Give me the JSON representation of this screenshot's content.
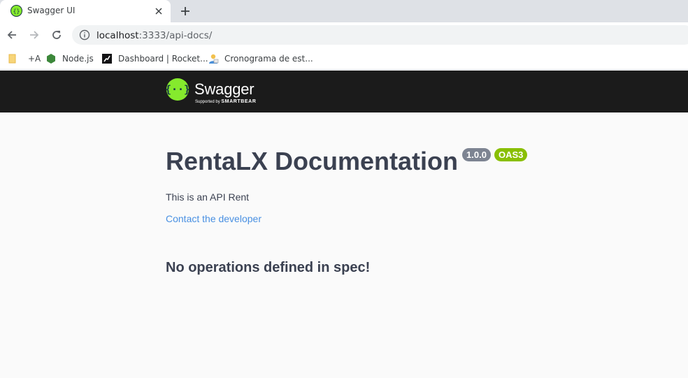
{
  "browser": {
    "tab": {
      "title": "Swagger UI"
    },
    "address": {
      "host": "localhost",
      "path": ":3333/api-docs/"
    },
    "bookmarks": [
      {
        "label": "+A",
        "icon": "folder-icon"
      },
      {
        "label": "Node.js",
        "icon": "nodejs-icon"
      },
      {
        "label": "Dashboard | Rocket...",
        "icon": "rocketseat-icon"
      },
      {
        "label": "Cronograma de est...",
        "icon": "person-icon"
      }
    ]
  },
  "swagger": {
    "brand": "Swagger",
    "supported_by": "Supported by",
    "smartbear": "SMARTBEAR"
  },
  "info": {
    "title": "RentaLX Documentation",
    "version": "1.0.0",
    "oas": "OAS3",
    "description": "This is an API Rent",
    "contact": "Contact the developer",
    "no_operations": "No operations defined in spec!"
  },
  "colors": {
    "topbar": "#1b1b1b",
    "accent_green": "#85ea2d",
    "oas_badge": "#89bf04",
    "version_badge": "#7d8492",
    "link": "#4990e2",
    "text": "#3b4151"
  }
}
